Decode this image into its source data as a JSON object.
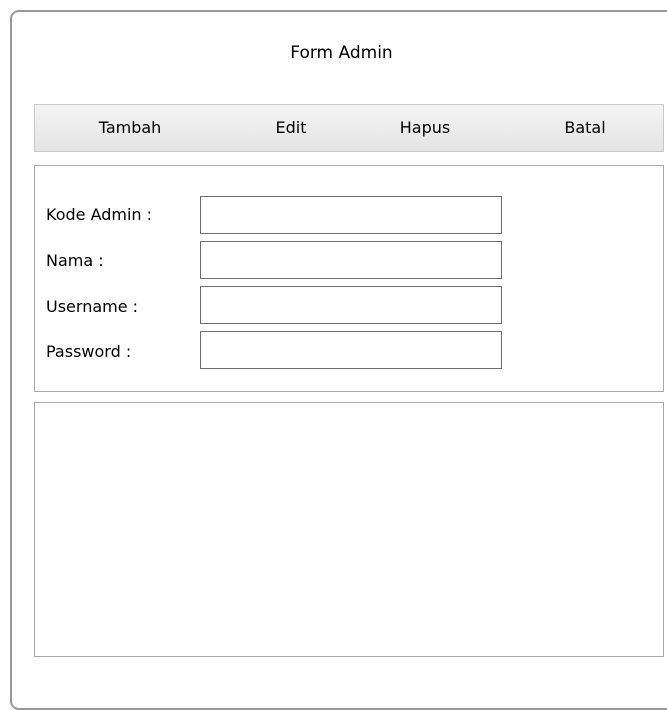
{
  "window": {
    "title": "Form Admin"
  },
  "toolbar": {
    "add_label": "Tambah",
    "edit_label": "Edit",
    "delete_label": "Hapus",
    "cancel_label": "Batal"
  },
  "form": {
    "fields": [
      {
        "label": "Kode Admin :",
        "value": ""
      },
      {
        "label": "Nama :",
        "value": ""
      },
      {
        "label": "Username :",
        "value": ""
      },
      {
        "label": "Password :",
        "value": ""
      }
    ]
  },
  "data_list": {
    "rows": []
  }
}
